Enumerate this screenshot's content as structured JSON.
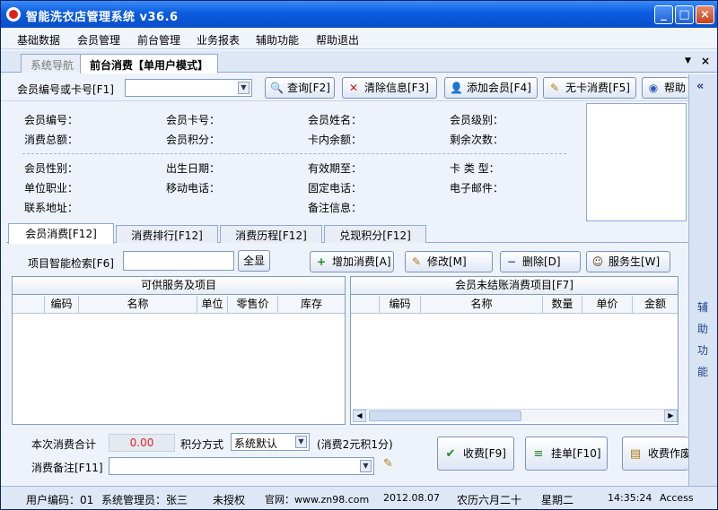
{
  "window": {
    "title": "智能洗衣店管理系统  v36.6"
  },
  "menu": [
    "基础数据",
    "会员管理",
    "前台管理",
    "业务报表",
    "辅助功能",
    "帮助退出"
  ],
  "doc_tabs": [
    "系统导航",
    "前台消费【单用户模式】"
  ],
  "tabstrip_controls": {
    "dropdown": "▼",
    "close": "×"
  },
  "toolbar": {
    "label": "会员编号或卡号[F1]",
    "input_value": "",
    "buttons": [
      "查询[F2]",
      "清除信息[F3]",
      "添加会员[F4]",
      "无卡消费[F5]",
      "帮助"
    ]
  },
  "sidebar": {
    "collapse": "«",
    "label": "辅助功能"
  },
  "member_info": {
    "row1": [
      "会员编号：",
      "会员卡号：",
      "会员姓名：",
      "会员级别："
    ],
    "row2": [
      "消费总额：",
      "会员积分：",
      "卡内余额：",
      "剩余次数："
    ],
    "row3": [
      "会员性别：",
      "出生日期：",
      "有效期至：",
      "卡 类 型："
    ],
    "row4": [
      "单位职业：",
      "移动电话：",
      "固定电话：",
      "电子邮件："
    ],
    "row5": [
      "联系地址：",
      "备注信息："
    ]
  },
  "sub_tabs": [
    "会员消费[F12]",
    "消费排行[F12]",
    "消费历程[F12]",
    "兑现积分[F12]"
  ],
  "search_row": {
    "label": "项目智能检索[F6]",
    "input_value": "",
    "show_all": "全显",
    "buttons": [
      "增加消费[A]",
      "修改[M]",
      "删除[D]",
      "服务生[W]"
    ]
  },
  "left_panel": {
    "title": "可供服务及项目",
    "columns": [
      "编码",
      "名称",
      "单位",
      "零售价",
      "库存"
    ]
  },
  "right_panel": {
    "title": "会员未结账消费项目[F7]",
    "columns": [
      "编码",
      "名称",
      "数量",
      "单价",
      "金额"
    ]
  },
  "bottom": {
    "total_label": "本次消费合计",
    "total_value": "0.00",
    "points_label": "积分方式",
    "points_mode": "系统默认",
    "points_rule": "(消费2元积1分)",
    "remark_label": "消费备注[F11]",
    "remark_value": "",
    "buttons": [
      "收费[F9]",
      "挂单[F10]",
      "收费作废"
    ]
  },
  "status": {
    "user_code": "用户编码：01",
    "admin": "系统管理员：张三",
    "license": "未授权",
    "website": "官网：www.zn98.com",
    "date": "2012.08.07",
    "lunar": "农历六月二十",
    "weekday": "星期二",
    "time": "14:35:24",
    "db": "Access"
  },
  "colors": {
    "title_bar": "#0b5ce0",
    "total_value": "#e02020",
    "accent": "#1b3f8f"
  }
}
